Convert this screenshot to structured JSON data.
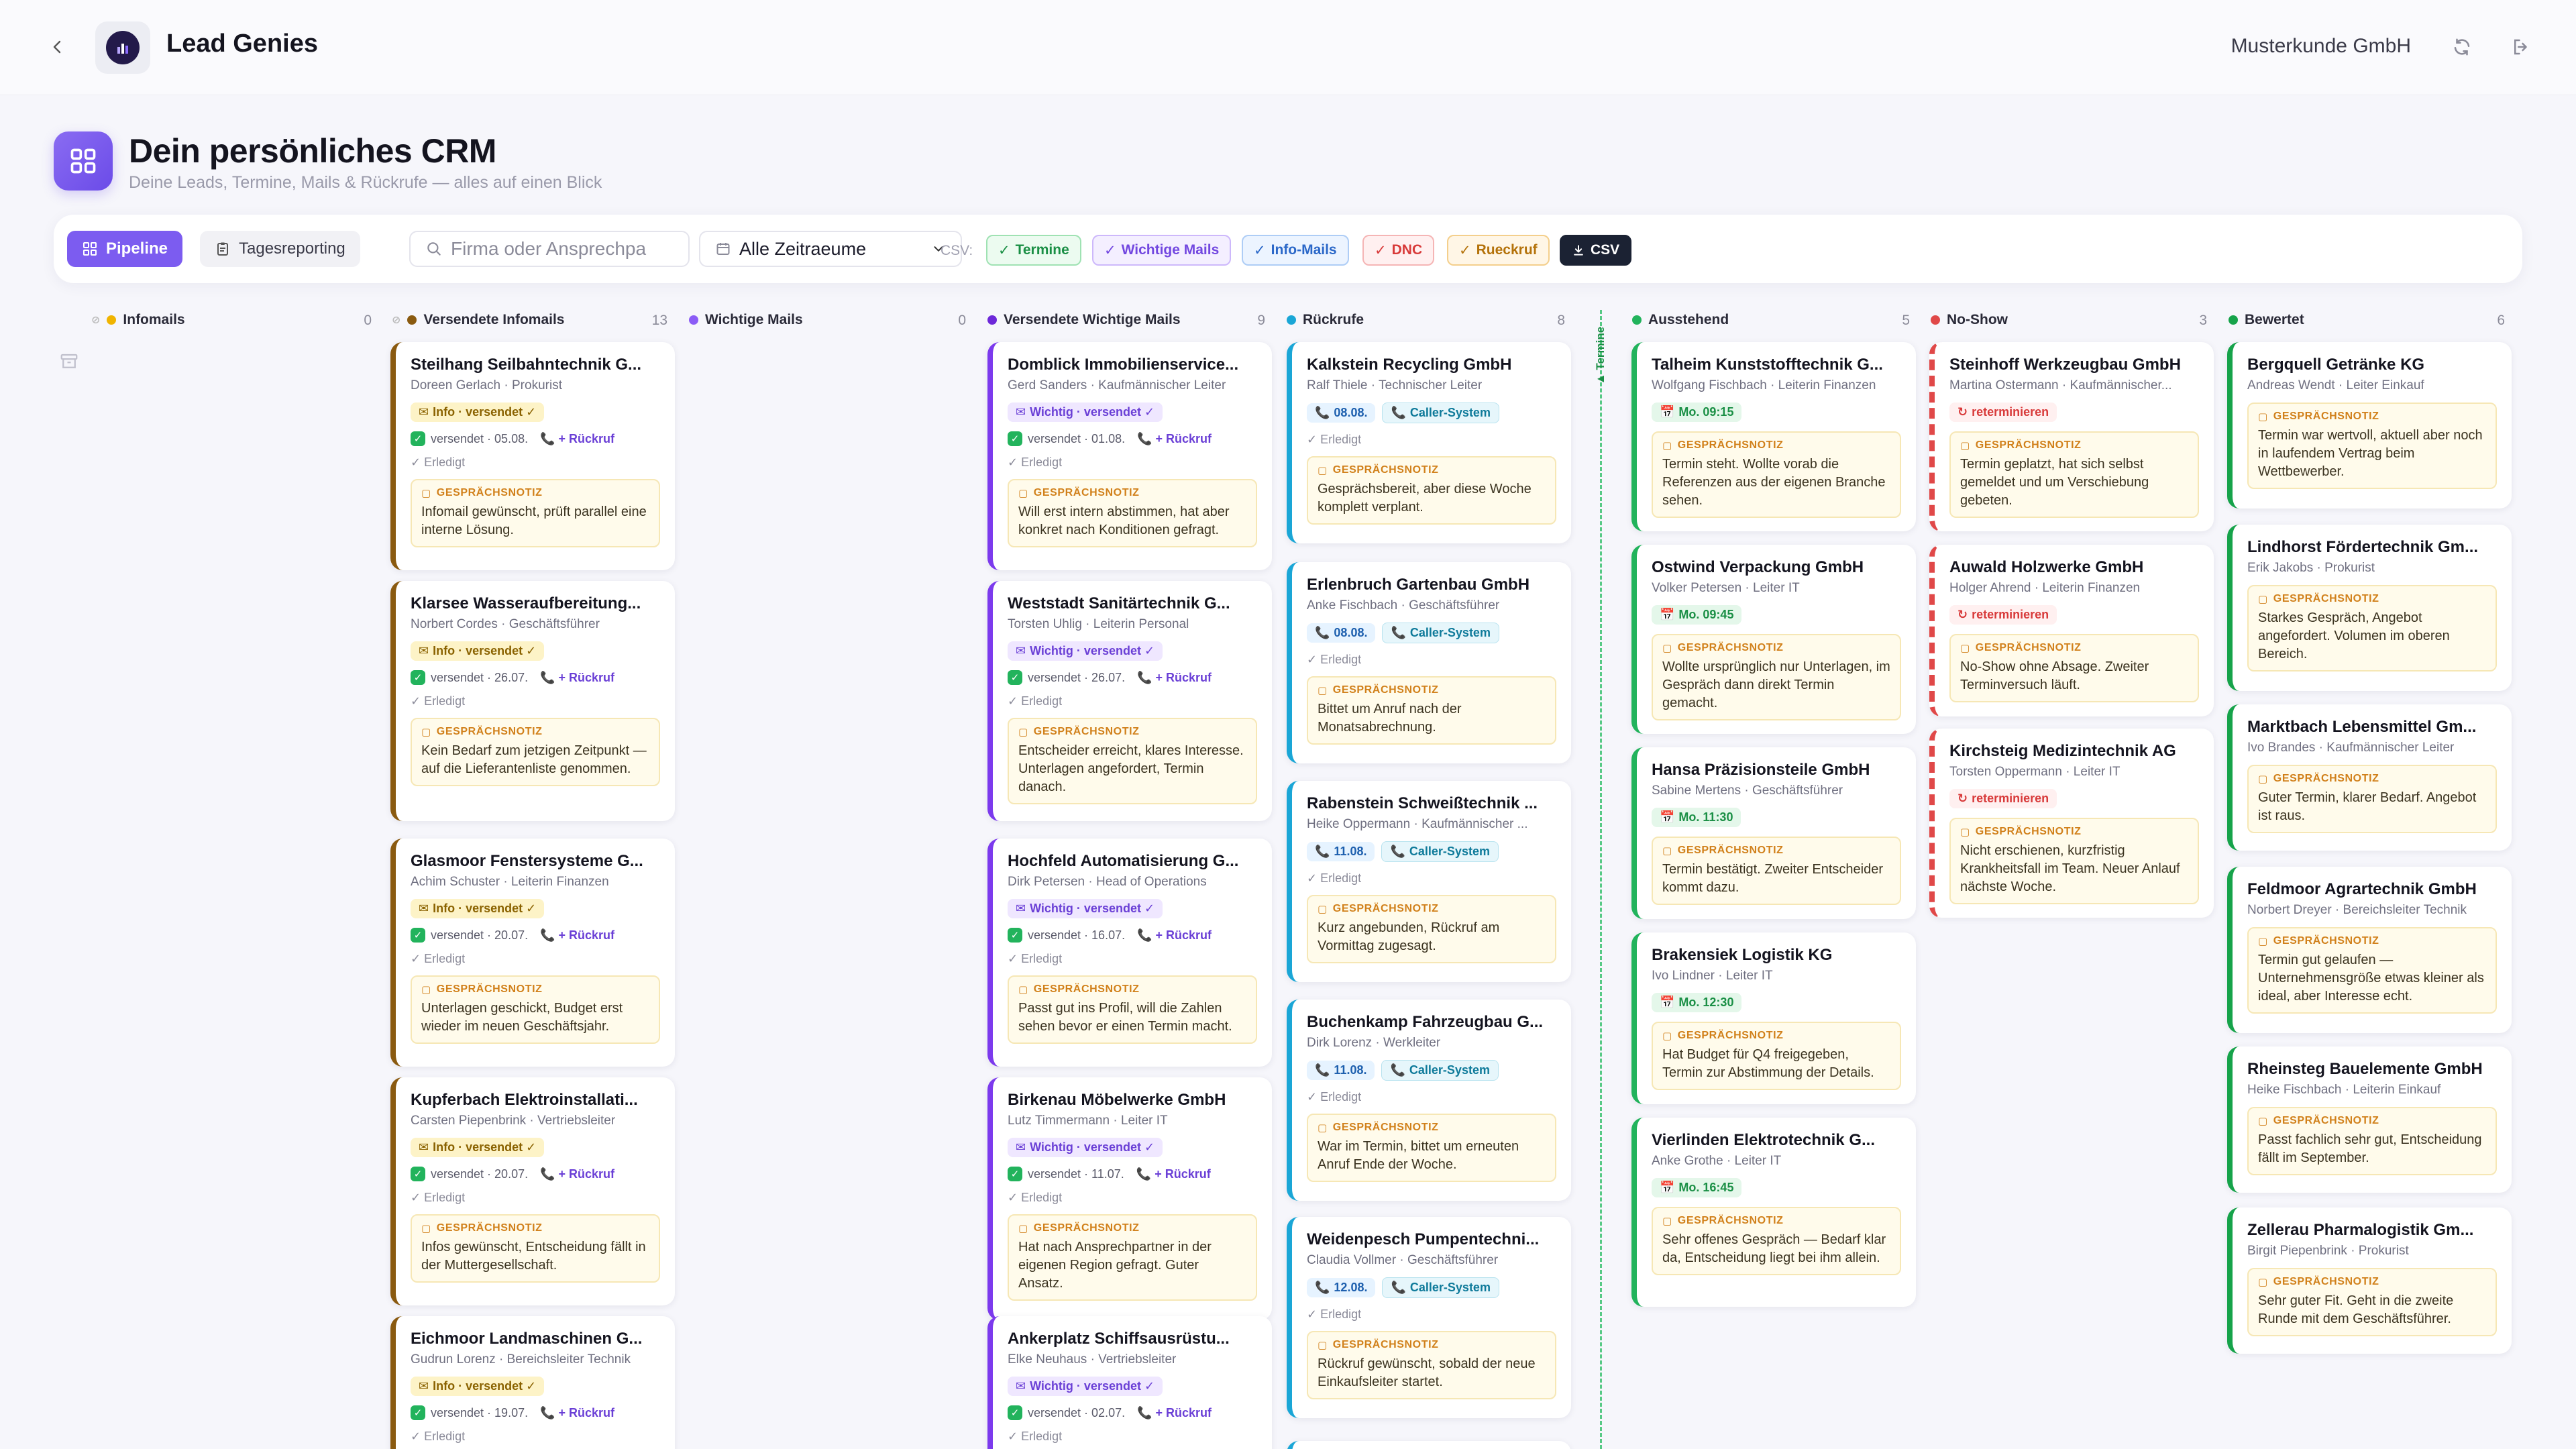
{
  "app": {
    "title": "Lead Genies",
    "customer": "Musterkunde GmbH"
  },
  "header": {
    "title": "Dein persönliches CRM",
    "subtitle": "Deine Leads, Termine, Mails & Rückrufe — alles auf einen Blick"
  },
  "toolbar": {
    "pipeline": "Pipeline",
    "report": "Tagesreporting",
    "search_placeholder": "Firma oder Ansprechpa",
    "range": "Alle Zeitraeume",
    "csv_label": "CSV:",
    "chips": {
      "termine": "Termine",
      "wichtig": "Wichtige Mails",
      "info": "Info-Mails",
      "dnc": "DNC",
      "rueck": "Rueckruf",
      "csv": "CSV"
    }
  },
  "common": {
    "note_header": "GESPRÄCHSNOTIZ",
    "erledigt": "✓ Erledigt",
    "rueckruf": "+ Rückruf",
    "info_badge": "Info · versendet ✓",
    "wichtig_badge": "Wichtig · versendet ✓",
    "caller": "Caller-System",
    "reterminieren": "reterminieren",
    "termine_divider": "▲ Termine"
  },
  "columns": [
    {
      "name": "Infomails",
      "count": "0"
    },
    {
      "name": "Versendete Infomails",
      "count": "13"
    },
    {
      "name": "Wichtige Mails",
      "count": "0"
    },
    {
      "name": "Versendete Wichtige Mails",
      "count": "9"
    },
    {
      "name": "Rückrufe",
      "count": "8"
    },
    {
      "name": "Ausstehend",
      "count": "5"
    },
    {
      "name": "No-Show",
      "count": "3"
    },
    {
      "name": "Bewertet",
      "count": "6"
    }
  ],
  "info_cards": [
    {
      "title": "Steilhang Seilbahntechnik G...",
      "sub": "Doreen Gerlach · Prokurist",
      "sent": "versendet · 05.08.",
      "note": "Infomail gewünscht, prüft parallel eine interne Lösung."
    },
    {
      "title": "Klarsee Wasseraufbereitung...",
      "sub": "Norbert Cordes · Geschäftsführer",
      "sent": "versendet · 26.07.",
      "note": "Kein Bedarf zum jetzigen Zeitpunkt — auf die Lieferantenliste genommen."
    },
    {
      "title": "Glasmoor Fenstersysteme G...",
      "sub": "Achim Schuster · Leiterin Finanzen",
      "sent": "versendet · 20.07.",
      "note": "Unterlagen geschickt, Budget erst wieder im neuen Geschäftsjahr."
    },
    {
      "title": "Kupferbach Elektroinstallati...",
      "sub": "Carsten Piepenbrink · Vertriebsleiter",
      "sent": "versendet · 20.07.",
      "note": "Infos gewünscht, Entscheidung fällt in der Muttergesellschaft."
    },
    {
      "title": "Eichmoor Landmaschinen G...",
      "sub": "Gudrun Lorenz · Bereichsleiter Technik",
      "sent": "versendet · 19.07.",
      "note": ""
    }
  ],
  "wichtig_cards": [
    {
      "title": "Domblick Immobilienservice...",
      "sub": "Gerd Sanders · Kaufmännischer Leiter",
      "sent": "versendet · 01.08.",
      "note": "Will erst intern abstimmen, hat aber konkret nach Konditionen gefragt."
    },
    {
      "title": "Weststadt Sanitärtechnik G...",
      "sub": "Torsten Uhlig · Leiterin Personal",
      "sent": "versendet · 26.07.",
      "note": "Entscheider erreicht, klares Interesse. Unterlagen angefordert, Termin danach."
    },
    {
      "title": "Hochfeld Automatisierung G...",
      "sub": "Dirk Petersen · Head of Operations",
      "sent": "versendet · 16.07.",
      "note": "Passt gut ins Profil, will die Zahlen sehen bevor er einen Termin macht."
    },
    {
      "title": "Birkenau Möbelwerke GmbH",
      "sub": "Lutz Timmermann · Leiter IT",
      "sent": "versendet · 11.07.",
      "note": "Hat nach Ansprechpartner in der eigenen Region gefragt. Guter Ansatz."
    },
    {
      "title": "Ankerplatz Schiffsausrüstu...",
      "sub": "Elke Neuhaus · Vertriebsleiter",
      "sent": "versendet · 02.07.",
      "note": ""
    }
  ],
  "rueck_cards": [
    {
      "title": "Kalkstein Recycling GmbH",
      "sub": "Ralf Thiele · Technischer Leiter",
      "date": "08.08.",
      "note": "Gesprächsbereit, aber diese Woche komplett verplant."
    },
    {
      "title": "Erlenbruch Gartenbau GmbH",
      "sub": "Anke Fischbach · Geschäftsführer",
      "date": "08.08.",
      "note": "Bittet um Anruf nach der Monatsabrechnung."
    },
    {
      "title": "Rabenstein Schweißtechnik ...",
      "sub": "Heike Oppermann · Kaufmännischer ...",
      "date": "11.08.",
      "note": "Kurz angebunden, Rückruf am Vormittag zugesagt."
    },
    {
      "title": "Buchenkamp Fahrzeugbau G...",
      "sub": "Dirk Lorenz · Werkleiter",
      "date": "11.08.",
      "note": "War im Termin, bittet um erneuten Anruf Ende der Woche."
    },
    {
      "title": "Weidenpesch Pumpentechni...",
      "sub": "Claudia Vollmer · Geschäftsführer",
      "date": "12.08.",
      "note": "Rückruf gewünscht, sobald der neue Einkaufsleiter startet."
    }
  ],
  "aus_cards": [
    {
      "title": "Talheim Kunststofftechnik G...",
      "sub": "Wolfgang Fischbach · Leiterin Finanzen",
      "term": "Mo. 09:15",
      "note": "Termin steht. Wollte vorab die Referenzen aus der eigenen Branche sehen."
    },
    {
      "title": "Ostwind Verpackung GmbH",
      "sub": "Volker Petersen · Leiter IT",
      "term": "Mo. 09:45",
      "note": "Wollte ursprünglich nur Unterlagen, im Gespräch dann direkt Termin gemacht."
    },
    {
      "title": "Hansa Präzisionsteile GmbH",
      "sub": "Sabine Mertens · Geschäftsführer",
      "term": "Mo. 11:30",
      "note": "Termin bestätigt. Zweiter Entscheider kommt dazu."
    },
    {
      "title": "Brakensiek Logistik KG",
      "sub": "Ivo Lindner · Leiter IT",
      "term": "Mo. 12:30",
      "note": "Hat Budget für Q4 freigegeben, Termin zur Abstimmung der Details."
    },
    {
      "title": "Vierlinden Elektrotechnik G...",
      "sub": "Anke Grothe · Leiter IT",
      "term": "Mo. 16:45",
      "note": "Sehr offenes Gespräch — Bedarf klar da, Entscheidung liegt bei ihm allein."
    }
  ],
  "noshow_cards": [
    {
      "title": "Steinhoff Werkzeugbau GmbH",
      "sub": "Martina Ostermann · Kaufmännischer...",
      "note": "Termin geplatzt, hat sich selbst gemeldet und um Verschiebung gebeten."
    },
    {
      "title": "Auwald Holzwerke GmbH",
      "sub": "Holger Ahrend · Leiterin Finanzen",
      "note": "No-Show ohne Absage. Zweiter Terminversuch läuft."
    },
    {
      "title": "Kirchsteig Medizintechnik AG",
      "sub": "Torsten Oppermann · Leiter IT",
      "note": "Nicht erschienen, kurzfristig Krankheitsfall im Team. Neuer Anlauf nächste Woche."
    }
  ],
  "bew_cards": [
    {
      "title": "Bergquell Getränke KG",
      "sub": "Andreas Wendt · Leiter Einkauf",
      "note": "Termin war wertvoll, aktuell aber noch in laufendem Vertrag beim Wettbewerber."
    },
    {
      "title": "Lindhorst Fördertechnik Gm...",
      "sub": "Erik Jakobs · Prokurist",
      "note": "Starkes Gespräch, Angebot angefordert. Volumen im oberen Bereich."
    },
    {
      "title": "Marktbach Lebensmittel Gm...",
      "sub": "Ivo Brandes · Kaufmännischer Leiter",
      "note": "Guter Termin, klarer Bedarf. Angebot ist raus."
    },
    {
      "title": "Feldmoor Agrartechnik GmbH",
      "sub": "Norbert Dreyer · Bereichsleiter Technik",
      "note": "Termin gut gelaufen — Unternehmensgröße etwas kleiner als ideal, aber Interesse echt."
    },
    {
      "title": "Rheinsteg Bauelemente GmbH",
      "sub": "Heike Fischbach · Leiterin Einkauf",
      "note": "Passt fachlich sehr gut, Entscheidung fällt im September."
    },
    {
      "title": "Zellerau Pharmalogistik Gm...",
      "sub": "Birgit Piepenbrink · Prokurist",
      "note": "Sehr guter Fit. Geht in die zweite Runde mit dem Geschäftsführer."
    }
  ],
  "colors": {
    "accent": "#7c5cf0",
    "info": "#8a5a10",
    "wichtig": "#7c3aed",
    "rueck": "#1aa6d6",
    "ausstehend": "#22b35c",
    "noshow": "#e04848",
    "bewertet": "#16a34a"
  }
}
